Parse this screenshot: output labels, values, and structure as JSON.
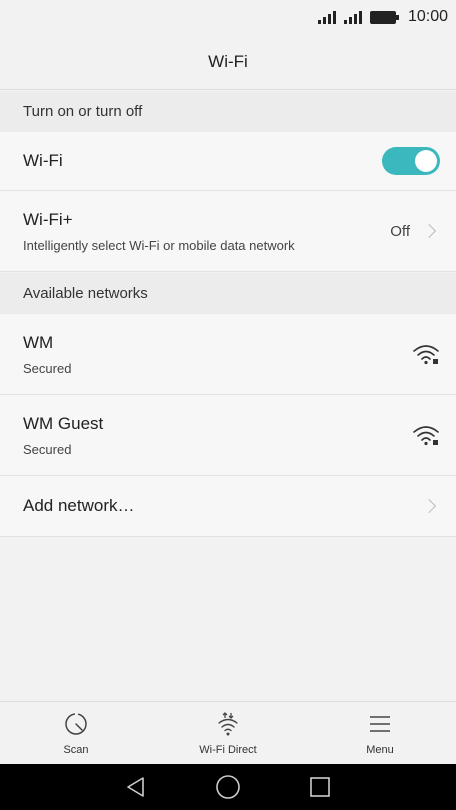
{
  "status_bar": {
    "time": "10:00"
  },
  "header": {
    "title": "Wi-Fi"
  },
  "sections": {
    "toggle_header": "Turn on or turn off",
    "available_header": "Available networks"
  },
  "wifi_row": {
    "label": "Wi-Fi",
    "enabled": true
  },
  "wifi_plus_row": {
    "label": "Wi-Fi+",
    "subtitle": "Intelligently select Wi-Fi or mobile data network",
    "value": "Off"
  },
  "networks": [
    {
      "name": "WM",
      "status": "Secured"
    },
    {
      "name": "WM Guest",
      "status": "Secured"
    }
  ],
  "add_network": {
    "label": "Add network…"
  },
  "bottom_bar": {
    "scan": "Scan",
    "wifi_direct": "Wi-Fi Direct",
    "menu": "Menu"
  },
  "colors": {
    "accent": "#3ab8bd",
    "background": "#f2f2f2",
    "nav_bar": "#000000"
  }
}
